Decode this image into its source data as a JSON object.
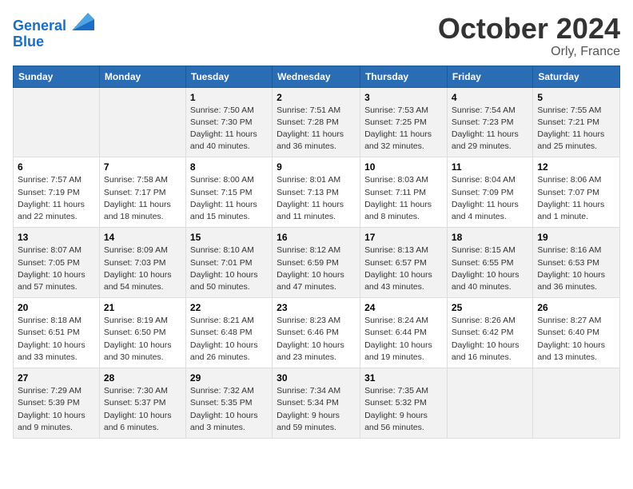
{
  "header": {
    "logo_line1": "General",
    "logo_line2": "Blue",
    "month": "October 2024",
    "location": "Orly, France"
  },
  "weekdays": [
    "Sunday",
    "Monday",
    "Tuesday",
    "Wednesday",
    "Thursday",
    "Friday",
    "Saturday"
  ],
  "weeks": [
    [
      {
        "day": "",
        "info": ""
      },
      {
        "day": "",
        "info": ""
      },
      {
        "day": "1",
        "info": "Sunrise: 7:50 AM\nSunset: 7:30 PM\nDaylight: 11 hours and 40 minutes."
      },
      {
        "day": "2",
        "info": "Sunrise: 7:51 AM\nSunset: 7:28 PM\nDaylight: 11 hours and 36 minutes."
      },
      {
        "day": "3",
        "info": "Sunrise: 7:53 AM\nSunset: 7:25 PM\nDaylight: 11 hours and 32 minutes."
      },
      {
        "day": "4",
        "info": "Sunrise: 7:54 AM\nSunset: 7:23 PM\nDaylight: 11 hours and 29 minutes."
      },
      {
        "day": "5",
        "info": "Sunrise: 7:55 AM\nSunset: 7:21 PM\nDaylight: 11 hours and 25 minutes."
      }
    ],
    [
      {
        "day": "6",
        "info": "Sunrise: 7:57 AM\nSunset: 7:19 PM\nDaylight: 11 hours and 22 minutes."
      },
      {
        "day": "7",
        "info": "Sunrise: 7:58 AM\nSunset: 7:17 PM\nDaylight: 11 hours and 18 minutes."
      },
      {
        "day": "8",
        "info": "Sunrise: 8:00 AM\nSunset: 7:15 PM\nDaylight: 11 hours and 15 minutes."
      },
      {
        "day": "9",
        "info": "Sunrise: 8:01 AM\nSunset: 7:13 PM\nDaylight: 11 hours and 11 minutes."
      },
      {
        "day": "10",
        "info": "Sunrise: 8:03 AM\nSunset: 7:11 PM\nDaylight: 11 hours and 8 minutes."
      },
      {
        "day": "11",
        "info": "Sunrise: 8:04 AM\nSunset: 7:09 PM\nDaylight: 11 hours and 4 minutes."
      },
      {
        "day": "12",
        "info": "Sunrise: 8:06 AM\nSunset: 7:07 PM\nDaylight: 11 hours and 1 minute."
      }
    ],
    [
      {
        "day": "13",
        "info": "Sunrise: 8:07 AM\nSunset: 7:05 PM\nDaylight: 10 hours and 57 minutes."
      },
      {
        "day": "14",
        "info": "Sunrise: 8:09 AM\nSunset: 7:03 PM\nDaylight: 10 hours and 54 minutes."
      },
      {
        "day": "15",
        "info": "Sunrise: 8:10 AM\nSunset: 7:01 PM\nDaylight: 10 hours and 50 minutes."
      },
      {
        "day": "16",
        "info": "Sunrise: 8:12 AM\nSunset: 6:59 PM\nDaylight: 10 hours and 47 minutes."
      },
      {
        "day": "17",
        "info": "Sunrise: 8:13 AM\nSunset: 6:57 PM\nDaylight: 10 hours and 43 minutes."
      },
      {
        "day": "18",
        "info": "Sunrise: 8:15 AM\nSunset: 6:55 PM\nDaylight: 10 hours and 40 minutes."
      },
      {
        "day": "19",
        "info": "Sunrise: 8:16 AM\nSunset: 6:53 PM\nDaylight: 10 hours and 36 minutes."
      }
    ],
    [
      {
        "day": "20",
        "info": "Sunrise: 8:18 AM\nSunset: 6:51 PM\nDaylight: 10 hours and 33 minutes."
      },
      {
        "day": "21",
        "info": "Sunrise: 8:19 AM\nSunset: 6:50 PM\nDaylight: 10 hours and 30 minutes."
      },
      {
        "day": "22",
        "info": "Sunrise: 8:21 AM\nSunset: 6:48 PM\nDaylight: 10 hours and 26 minutes."
      },
      {
        "day": "23",
        "info": "Sunrise: 8:23 AM\nSunset: 6:46 PM\nDaylight: 10 hours and 23 minutes."
      },
      {
        "day": "24",
        "info": "Sunrise: 8:24 AM\nSunset: 6:44 PM\nDaylight: 10 hours and 19 minutes."
      },
      {
        "day": "25",
        "info": "Sunrise: 8:26 AM\nSunset: 6:42 PM\nDaylight: 10 hours and 16 minutes."
      },
      {
        "day": "26",
        "info": "Sunrise: 8:27 AM\nSunset: 6:40 PM\nDaylight: 10 hours and 13 minutes."
      }
    ],
    [
      {
        "day": "27",
        "info": "Sunrise: 7:29 AM\nSunset: 5:39 PM\nDaylight: 10 hours and 9 minutes."
      },
      {
        "day": "28",
        "info": "Sunrise: 7:30 AM\nSunset: 5:37 PM\nDaylight: 10 hours and 6 minutes."
      },
      {
        "day": "29",
        "info": "Sunrise: 7:32 AM\nSunset: 5:35 PM\nDaylight: 10 hours and 3 minutes."
      },
      {
        "day": "30",
        "info": "Sunrise: 7:34 AM\nSunset: 5:34 PM\nDaylight: 9 hours and 59 minutes."
      },
      {
        "day": "31",
        "info": "Sunrise: 7:35 AM\nSunset: 5:32 PM\nDaylight: 9 hours and 56 minutes."
      },
      {
        "day": "",
        "info": ""
      },
      {
        "day": "",
        "info": ""
      }
    ]
  ]
}
